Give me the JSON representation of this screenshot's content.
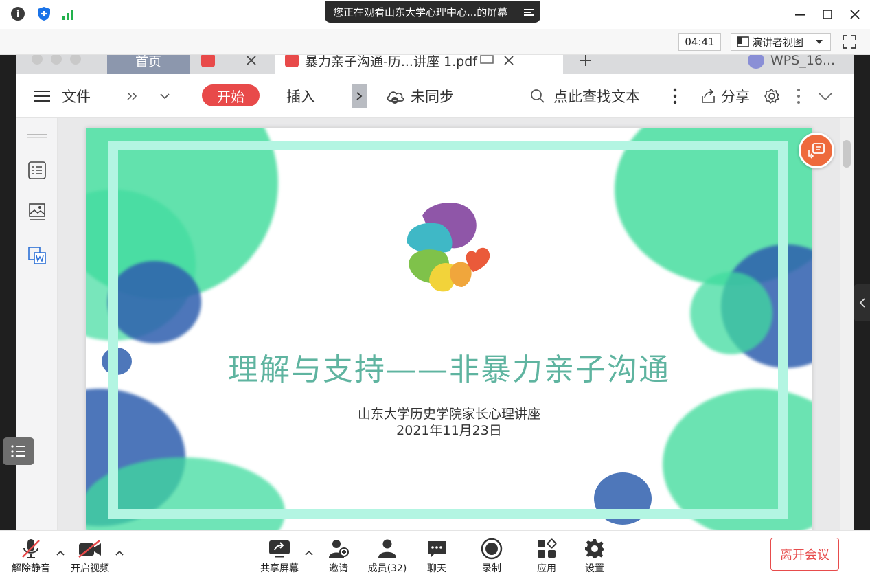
{
  "window": {
    "share_banner": "您正在观看山东大学心理中心...的屏幕",
    "controls": [
      "minimize",
      "maximize",
      "close"
    ]
  },
  "infobar": {
    "timer": "04:41",
    "presenter_view": "演讲者视图"
  },
  "wps": {
    "tabs": [
      "首页",
      "暴力亲子沟通-历...讲座 1.pdf",
      "WPS_16..."
    ],
    "toolbar": {
      "file": "文件",
      "start": "开始",
      "insert": "插入",
      "sync": "未同步",
      "search": "点此查找文本",
      "share": "分享"
    }
  },
  "slide": {
    "title": "理解与支持——非暴力亲子沟通",
    "subtitle": "山东大学历史学院家长心理讲座",
    "date": "2021年11月23日"
  },
  "bottombar": {
    "unmute": "解除静音",
    "start_video": "开启视频",
    "share_screen": "共享屏幕",
    "invite": "邀请",
    "members": "成员(32)",
    "chat": "聊天",
    "record": "录制",
    "apps": "应用",
    "settings": "设置",
    "leave": "离开会议"
  },
  "colors": {
    "accent_red": "#e84a4a",
    "slide_title": "#5fb4a0",
    "watercolor_green": "#3fdc9f",
    "watercolor_blue": "#2f5fae",
    "frame": "#b3f5e2"
  }
}
